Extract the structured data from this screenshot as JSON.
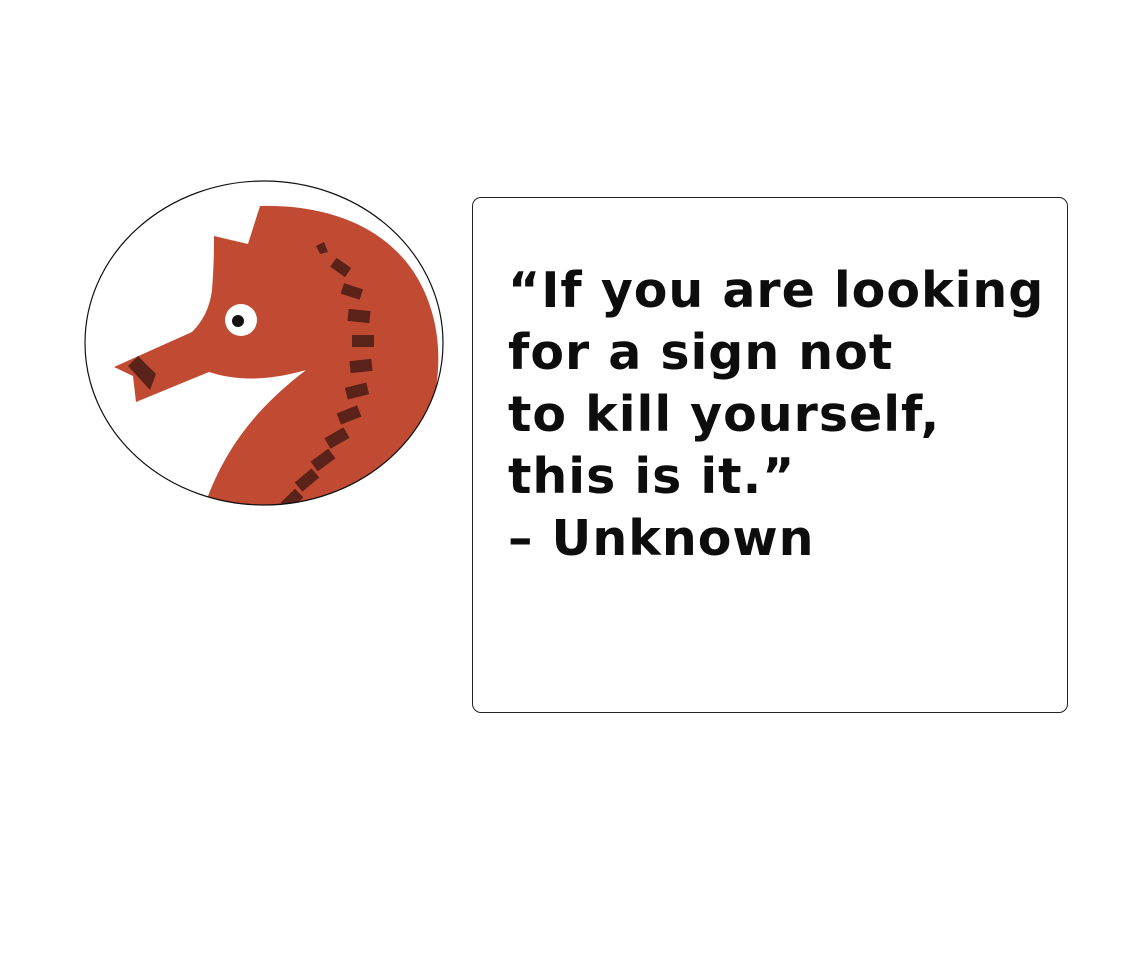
{
  "avatar": {
    "icon": "seahorse-icon",
    "colors": {
      "body": "#c14a33",
      "stripes": "#5a2218",
      "outline": "#111111",
      "eye": "#ffffff",
      "pupil": "#111111"
    }
  },
  "quote": {
    "lines": [
      "“If you are looking",
      "for a sign not",
      "to kill yourself,",
      "this is it.”"
    ],
    "attribution": "– Unknown"
  }
}
